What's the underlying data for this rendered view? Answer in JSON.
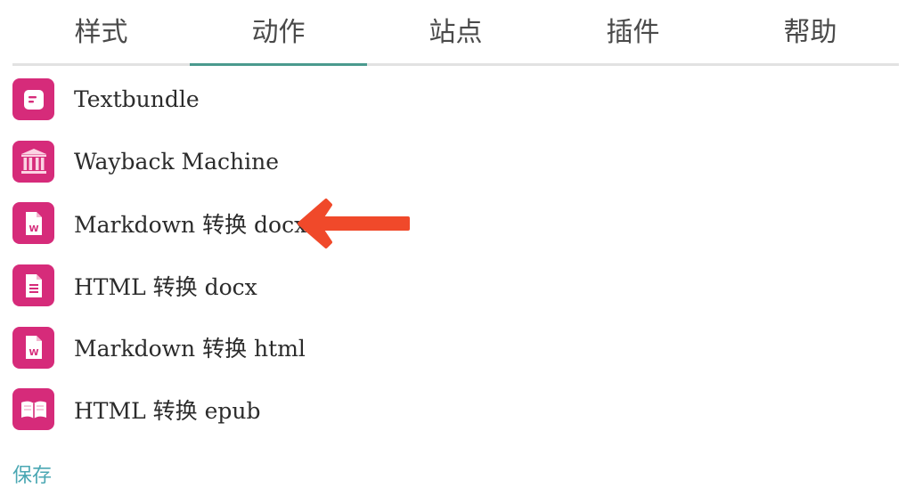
{
  "tabs": [
    {
      "label": "样式"
    },
    {
      "label": "动作"
    },
    {
      "label": "站点"
    },
    {
      "label": "插件"
    },
    {
      "label": "帮助"
    }
  ],
  "active_tab": "动作",
  "items": [
    {
      "label": "Textbundle",
      "icon": "textbundle-icon"
    },
    {
      "label": "Wayback Machine",
      "icon": "archive-building-icon"
    },
    {
      "label": "Markdown 转换 docx",
      "icon": "word-document-icon"
    },
    {
      "label": "HTML 转换 docx",
      "icon": "text-document-icon"
    },
    {
      "label": "Markdown 转换 html",
      "icon": "word-document-icon"
    },
    {
      "label": "HTML 转换 epub",
      "icon": "open-book-icon"
    }
  ],
  "footer": {
    "save_label": "保存"
  },
  "colors": {
    "icon_bg": "#d62b7a",
    "active_tab_indicator": "#4a9a8e",
    "arrow": "#f0492a",
    "save_link": "#4aa7b3"
  }
}
